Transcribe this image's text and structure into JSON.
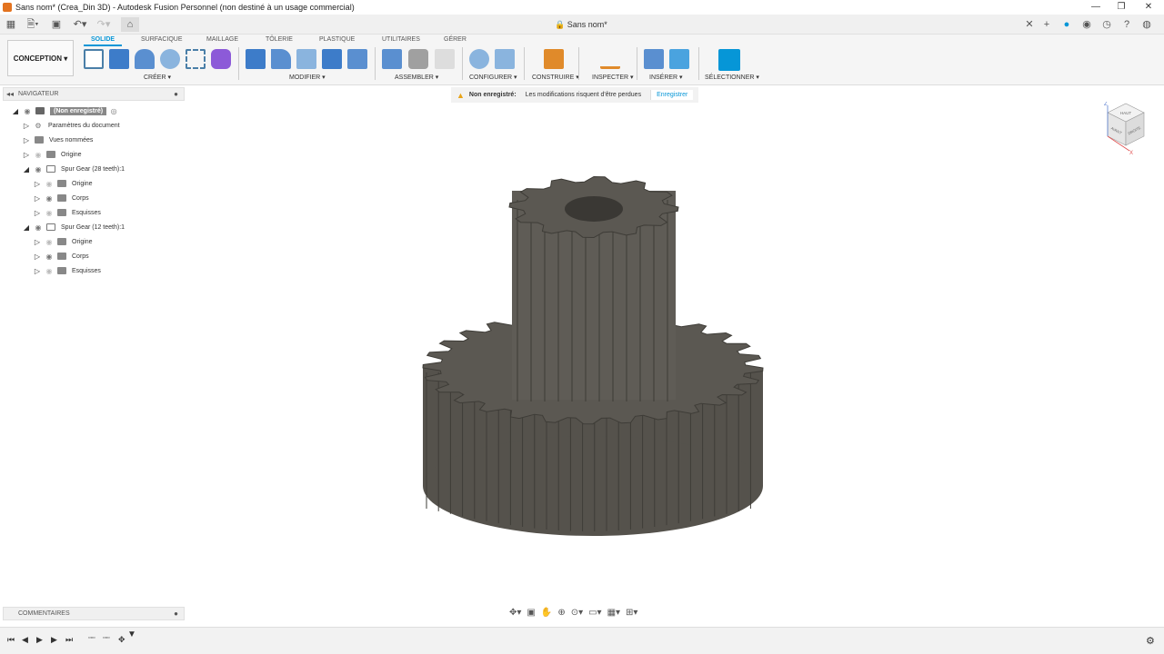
{
  "window": {
    "title": "Sans nom* (Crea_Din 3D) - Autodesk Fusion Personnel (non destiné à un usage commercial)",
    "doc_tab": "Sans nom*"
  },
  "ribbon": {
    "workspace": "CONCEPTION ▾",
    "tabs": [
      "SOLIDE",
      "SURFACIQUE",
      "MAILLAGE",
      "TÔLERIE",
      "PLASTIQUE",
      "UTILITAIRES",
      "GÉRER"
    ],
    "groups": [
      "CRÉER ▾",
      "MODIFIER ▾",
      "ASSEMBLER ▾",
      "CONFIGURER ▾",
      "CONSTRUIRE ▾",
      "INSPECTER ▾",
      "INSÉRER ▾",
      "SÉLECTIONNER ▾"
    ]
  },
  "warning": {
    "title": "Non enregistré:",
    "message": "Les modifications risquent d'être perdues",
    "action": "Enregistrer"
  },
  "navigator": {
    "header": "NAVIGATEUR",
    "items": [
      {
        "label": "(Non enregistré)"
      },
      {
        "label": "Paramètres du document"
      },
      {
        "label": "Vues nommées"
      },
      {
        "label": "Origine"
      },
      {
        "label": "Spur Gear (28 teeth):1"
      },
      {
        "label": "Origine"
      },
      {
        "label": "Corps"
      },
      {
        "label": "Esquisses"
      },
      {
        "label": "Spur Gear (12 teeth):1"
      },
      {
        "label": "Origine"
      },
      {
        "label": "Corps"
      },
      {
        "label": "Esquisses"
      }
    ]
  },
  "viewcube": {
    "top": "HAUT",
    "front": "AVANT",
    "right": "DROITE",
    "axis_z": "Z",
    "axis_x": "X"
  },
  "comments": {
    "label": "COMMENTAIRES"
  },
  "colors": {
    "accent": "#0696d7",
    "gear": "#5b5852",
    "highlight": "#4a4a4a"
  }
}
